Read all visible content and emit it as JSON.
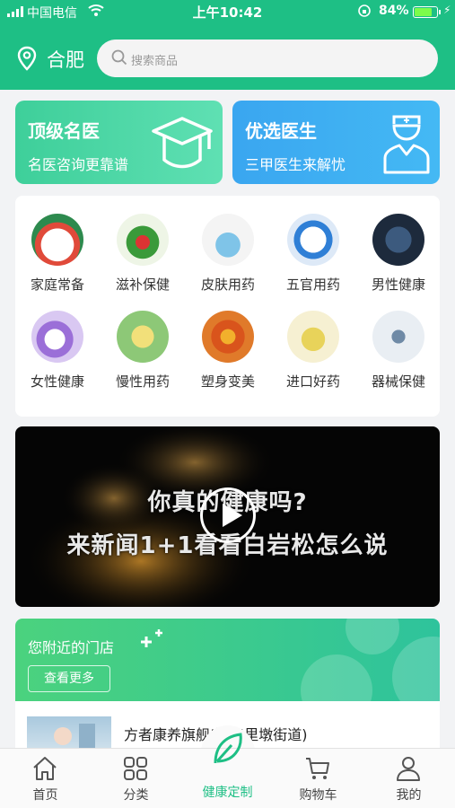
{
  "status_bar": {
    "carrier": "中国电信",
    "time": "上午10:42",
    "battery_percent": "84%",
    "battery_level": 0.84
  },
  "header": {
    "city": "合肥",
    "search_placeholder": "搜索商品"
  },
  "feature_cards": [
    {
      "title": "顶级名医",
      "subtitle": "名医咨询更靠谱",
      "icon": "graduation-cap-icon"
    },
    {
      "title": "优选医生",
      "subtitle": "三甲医生来解忧",
      "icon": "doctor-icon"
    }
  ],
  "categories": [
    {
      "label": "家庭常备"
    },
    {
      "label": "滋补保健"
    },
    {
      "label": "皮肤用药"
    },
    {
      "label": "五官用药"
    },
    {
      "label": "男性健康"
    },
    {
      "label": "女性健康"
    },
    {
      "label": "慢性用药"
    },
    {
      "label": "塑身变美"
    },
    {
      "label": "进口好药"
    },
    {
      "label": "器械保健"
    }
  ],
  "video": {
    "line1": "你真的健康吗?",
    "line2": "来新闻1+1看看白岩松怎么说"
  },
  "nearby": {
    "title": "您附近的门店",
    "more_button": "查看更多"
  },
  "store": {
    "name": "方者康养旗舰店(五里墩街道)"
  },
  "tabbar": [
    {
      "label": "首页",
      "icon": "home-icon"
    },
    {
      "label": "分类",
      "icon": "category-grid-icon"
    },
    {
      "label": "健康定制",
      "icon": "leaf-icon",
      "active": true
    },
    {
      "label": "购物车",
      "icon": "cart-icon"
    },
    {
      "label": "我的",
      "icon": "user-icon"
    }
  ],
  "colors": {
    "brand_green": "#1ebf85",
    "card_blue": "#3aa6f0"
  }
}
